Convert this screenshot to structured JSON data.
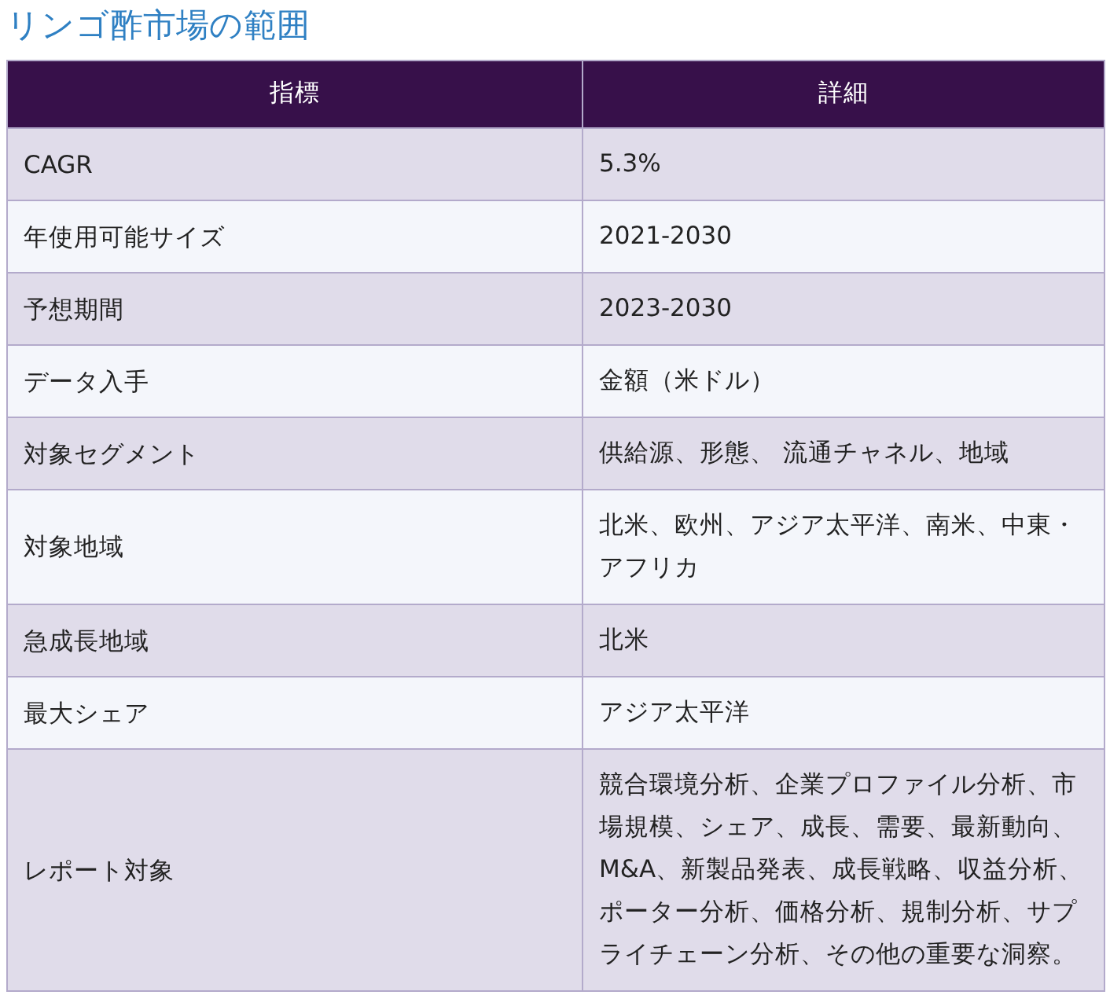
{
  "title": "リンゴ酢市場の範囲",
  "table": {
    "columns": [
      "指標",
      "詳細"
    ],
    "rows": [
      [
        "CAGR",
        "5.3%"
      ],
      [
        "年使用可能サイズ",
        "2021-2030"
      ],
      [
        "予想期間",
        "2023-2030"
      ],
      [
        "データ入手",
        "金額（米ドル）"
      ],
      [
        "対象セグメント",
        "供給源、形態、 流通チャネル、地域"
      ],
      [
        "対象地域",
        "北米、欧州、アジア太平洋、南米、中東・アフリカ"
      ],
      [
        "急成長地域",
        "北米"
      ],
      [
        "最大シェア",
        "アジア太平洋"
      ],
      [
        "レポート対象",
        "競合環境分析、企業プロファイル分析、市場規模、シェア、成長、需要、最新動向、M&A、新製品発表、成長戦略、収益分析、ポーター分析、価格分析、規制分析、サプライチェーン分析、その他の重要な洞察。"
      ]
    ]
  }
}
